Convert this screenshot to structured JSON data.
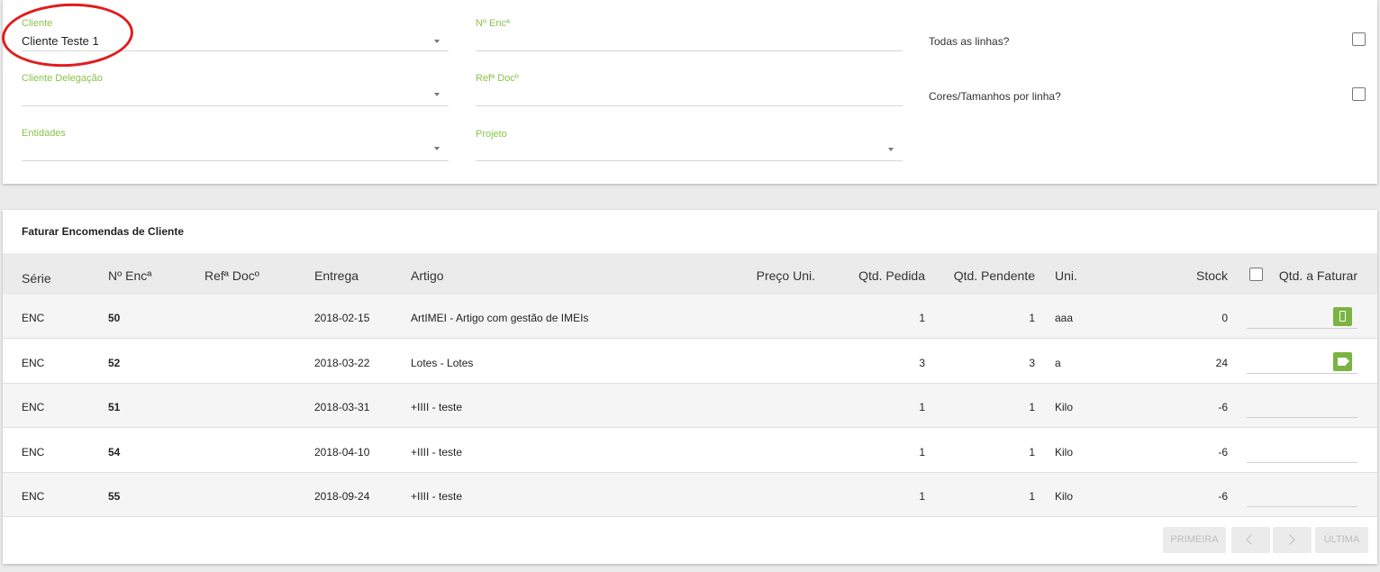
{
  "filters": {
    "cliente": {
      "label": "Cliente",
      "value": "Cliente Teste 1"
    },
    "num_enc": {
      "label": "Nº Encª",
      "value": ""
    },
    "cliente_delegacao": {
      "label": "Cliente Delegação",
      "value": ""
    },
    "ref_doc": {
      "label": "Refª Docº",
      "value": ""
    },
    "entidades": {
      "label": "Entidades",
      "value": ""
    },
    "projeto": {
      "label": "Projeto",
      "value": ""
    },
    "todas_linhas": {
      "label": "Todas as linhas?",
      "checked": false
    },
    "cores_tamanhos": {
      "label": "Cores/Tamanhos por linha?",
      "checked": false
    }
  },
  "table": {
    "title": "Faturar Encomendas de Cliente",
    "headers": {
      "serie": "Série",
      "num_enc": "Nº Encª",
      "ref_doc": "Refª Docº",
      "entrega": "Entrega",
      "artigo": "Artigo",
      "preco_uni": "Preço Uni.",
      "qtd_pedida": "Qtd. Pedida",
      "qtd_pendente": "Qtd. Pendente",
      "uni": "Uni.",
      "stock": "Stock",
      "qtd_faturar": "Qtd. a Faturar"
    },
    "rows": [
      {
        "serie": "ENC",
        "num_enc": "50",
        "ref_doc": "",
        "entrega": "2018-02-15",
        "artigo": "ArtIMEI - Artigo com gestão de IMEIs",
        "preco_uni": "",
        "qtd_pedida": "1",
        "qtd_pendente": "1",
        "uni": "aaa",
        "stock": "0",
        "action_icon": "phone-icon"
      },
      {
        "serie": "ENC",
        "num_enc": "52",
        "ref_doc": "",
        "entrega": "2018-03-22",
        "artigo": "Lotes - Lotes",
        "preco_uni": "",
        "qtd_pedida": "3",
        "qtd_pendente": "3",
        "uni": "a",
        "stock": "24",
        "action_icon": "tag-icon"
      },
      {
        "serie": "ENC",
        "num_enc": "51",
        "ref_doc": "",
        "entrega": "2018-03-31",
        "artigo": "+IIII - teste",
        "preco_uni": "",
        "qtd_pedida": "1",
        "qtd_pendente": "1",
        "uni": "Kilo",
        "stock": "-6",
        "action_icon": ""
      },
      {
        "serie": "ENC",
        "num_enc": "54",
        "ref_doc": "",
        "entrega": "2018-04-10",
        "artigo": "+IIII - teste",
        "preco_uni": "",
        "qtd_pedida": "1",
        "qtd_pendente": "1",
        "uni": "Kilo",
        "stock": "-6",
        "action_icon": ""
      },
      {
        "serie": "ENC",
        "num_enc": "55",
        "ref_doc": "",
        "entrega": "2018-09-24",
        "artigo": "+IIII - teste",
        "preco_uni": "",
        "qtd_pedida": "1",
        "qtd_pendente": "1",
        "uni": "Kilo",
        "stock": "-6",
        "action_icon": ""
      }
    ]
  },
  "pagination": {
    "first": "PRIMEIRA",
    "last": "ÚLTIMA"
  },
  "colors": {
    "accent": "#8bc34a",
    "action": "#7cb342",
    "annotation": "#e11c1c"
  }
}
